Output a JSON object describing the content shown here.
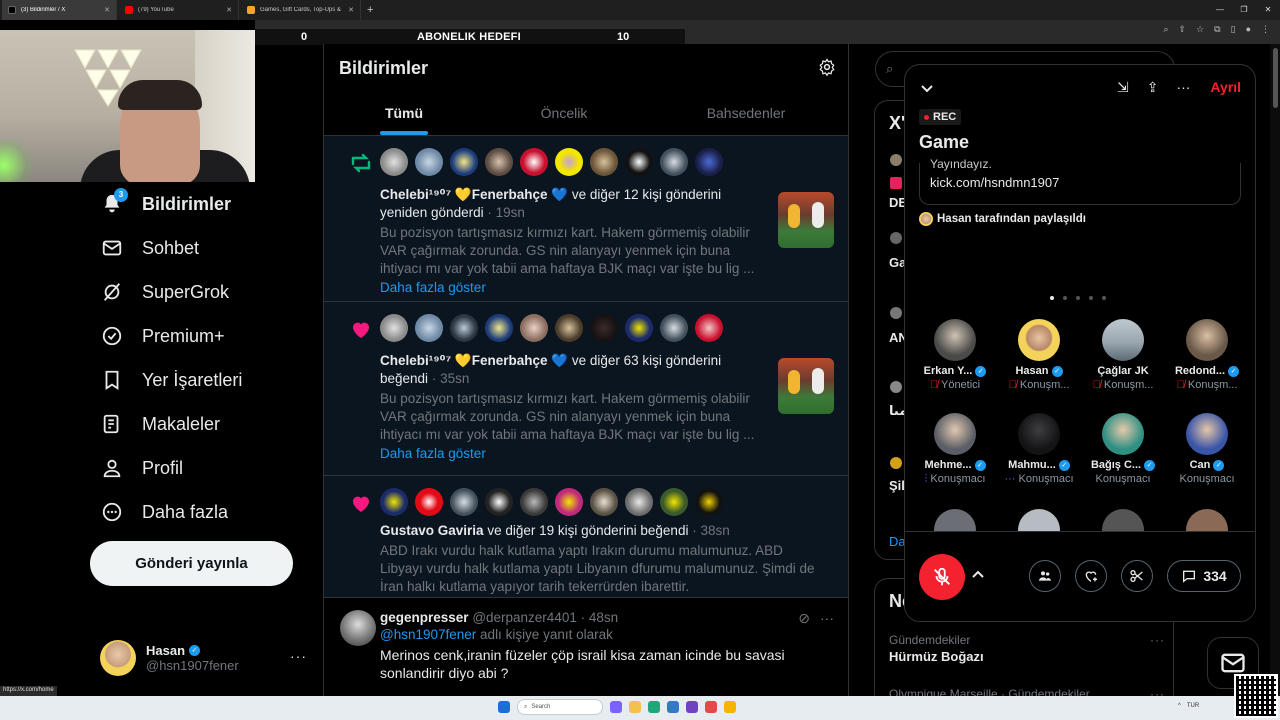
{
  "browser": {
    "tabs": [
      {
        "label": "(3) Bildirimler / X",
        "active": true
      },
      {
        "label": "(79) YouTube",
        "active": false
      },
      {
        "label": "Games, Gift Cards, Top-Ups & ...",
        "active": false
      }
    ],
    "new_tab": "+",
    "status_url": "https://x.com/home"
  },
  "stream_overlay": {
    "left_value": "0",
    "center_label": "ABONELIK HEDEFI",
    "right_value": "10"
  },
  "sidebar": {
    "items": [
      {
        "label": "Bildirimler",
        "icon": "bell-icon",
        "badge": "3",
        "active": true
      },
      {
        "label": "Sohbet",
        "icon": "mail-icon",
        "active": false
      },
      {
        "label": "SuperGrok",
        "icon": "grok-icon",
        "active": false
      },
      {
        "label": "Premium+",
        "icon": "verified-icon",
        "active": false
      },
      {
        "label": "Yer İşaretleri",
        "icon": "bookmark-icon",
        "active": false
      },
      {
        "label": "Makaleler",
        "icon": "article-icon",
        "active": false
      },
      {
        "label": "Profil",
        "icon": "person-icon",
        "active": false
      },
      {
        "label": "Daha fazla",
        "icon": "more-circle-icon",
        "active": false
      }
    ],
    "post_button": "Gönderi yayınla",
    "account": {
      "name": "Hasan",
      "handle": "@hsn1907fener",
      "more": "···"
    }
  },
  "main": {
    "title": "Bildirimler",
    "tabs": [
      "Tümü",
      "Öncelik",
      "Bahsedenler"
    ],
    "notifications": [
      {
        "type": "repost",
        "actor": "Chelebi¹⁹⁰⁷ 💛Fenerbahçe 💙",
        "action": "ve diğer 12 kişi gönderini yeniden gönderdi",
        "time": "19sn",
        "snippet": "Bu pozisyon tartışmasız kırmızı kart. Hakem görmemiş olabilir VAR çağırmak zorunda. GS nin alanyayı yenmek için buna ihtiyacı mı var yok tabii ama haftaya BJK maçı var işte bu lig ...",
        "more": "Daha fazla göster"
      },
      {
        "type": "like",
        "actor": "Chelebi¹⁹⁰⁷ 💛Fenerbahçe 💙",
        "action": "ve diğer 63 kişi gönderini beğendi",
        "time": "35sn",
        "snippet": "Bu pozisyon tartışmasız kırmızı kart. Hakem görmemiş olabilir VAR çağırmak zorunda. GS nin alanyayı yenmek için buna ihtiyacı mı var yok tabii ama haftaya BJK maçı var işte bu lig ...",
        "more": "Daha fazla göster"
      },
      {
        "type": "like",
        "actor": "Gustavo Gaviria",
        "action": "ve diğer 19 kişi gönderini beğendi",
        "time": "38sn",
        "snippet": "ABD Irakı vurdu halk kutlama yaptı Irakın durumu malumunuz. ABD Libyayı vurdu halk kutlama yaptı Libyanın dfurumu malumunuz. Şimdi de İran halkı kutlama yapıyor tarih tekerrürden ibarettir."
      }
    ],
    "reply": {
      "name": "gegenpresser",
      "handle": "@derpanzer4401",
      "time": "48sn",
      "reply_prefix": "@hsn1907fener",
      "reply_suffix": "adlı kişiye yanıt olarak",
      "text": "Merinos cenk,iranin füzeler çöp israil kisa zaman icinde bu savasi sonlandirir diyo abi  ?"
    }
  },
  "right": {
    "fragments": [
      "X'",
      "DE",
      "Ga",
      "AN",
      "مںا",
      "Şil",
      "Da"
    ],
    "trends_title": "Ne",
    "trend_meta": "Gündemdekiler",
    "trend_name": "Hürmüz Boğazı",
    "trend_meta2": "Olympique Marseille · Gündemdekiler"
  },
  "space": {
    "leave": "Ayrıl",
    "rec": "REC",
    "title": "Game",
    "pinned_cut": "Yayındayız.",
    "pinned_link": "kick.com/hsndmn1907",
    "shared_by": "Hasan tarafından paylaşıldı",
    "people": [
      {
        "name": "Erkan Y...",
        "role": "Yönetici",
        "verified": true,
        "mic": "off"
      },
      {
        "name": "Hasan",
        "role": "Konuşm...",
        "verified": true,
        "mic": "off"
      },
      {
        "name": "Çağlar JK",
        "role": "Konuşm...",
        "verified": false,
        "mic": "off"
      },
      {
        "name": "Redond...",
        "role": "Konuşm...",
        "verified": true,
        "mic": "off"
      },
      {
        "name": "Mehme...",
        "role": "Konuşmacı",
        "verified": true,
        "mic": "wave"
      },
      {
        "name": "Mahmu...",
        "role": "Konuşmacı",
        "verified": true,
        "mic": "dots"
      },
      {
        "name": "Bağış C...",
        "role": "Konuşmacı",
        "verified": true,
        "mic": "none"
      },
      {
        "name": "Can",
        "role": "Konuşmacı",
        "verified": true,
        "mic": "none"
      }
    ],
    "comment_count": "334",
    "colors": {
      "accent": "#1d9bf0",
      "danger": "#f4212e"
    }
  },
  "taskbar": {
    "search": "Search",
    "lang": "TUR"
  }
}
